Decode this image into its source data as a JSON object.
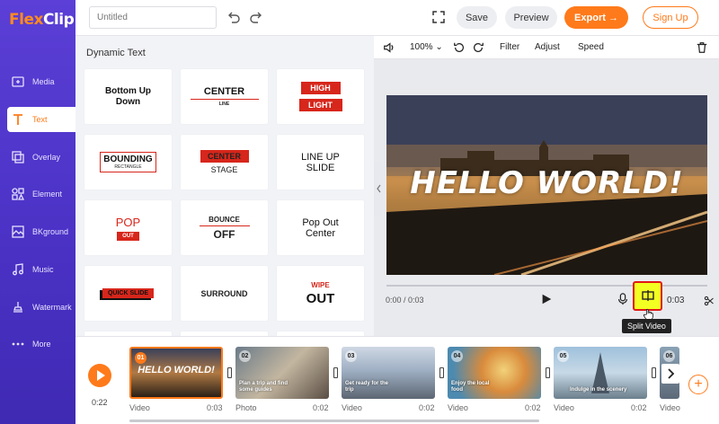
{
  "app": {
    "logo_text_a": "Flex",
    "logo_text_b": "Clip",
    "accent_color": "#ff7a1a",
    "sidebar_color": "#4a31c4"
  },
  "sidebar": {
    "items": [
      {
        "label": "Media",
        "icon": "media-icon"
      },
      {
        "label": "Text",
        "icon": "text-icon",
        "active": true
      },
      {
        "label": "Overlay",
        "icon": "overlay-icon"
      },
      {
        "label": "Element",
        "icon": "element-icon"
      },
      {
        "label": "BKground",
        "icon": "background-icon"
      },
      {
        "label": "Music",
        "icon": "music-icon"
      },
      {
        "label": "Watermark",
        "icon": "watermark-icon"
      },
      {
        "label": "More",
        "icon": "more-icon"
      }
    ]
  },
  "header": {
    "title_placeholder": "Untitled",
    "save_label": "Save",
    "preview_label": "Preview",
    "export_label": "Export →",
    "signup_label": "Sign Up"
  },
  "panel": {
    "title": "Dynamic Text",
    "cards": [
      {
        "lines": [
          "Bottom Up",
          "Down"
        ]
      },
      {
        "lines": [
          "CENTER",
          "LINE"
        ]
      },
      {
        "lines": [
          "HIGH",
          "LIGHT"
        ]
      },
      {
        "lines": [
          "BOUNDING",
          "RECTANGLE"
        ]
      },
      {
        "lines": [
          "CENTER",
          "STAGE"
        ]
      },
      {
        "lines": [
          "LINE UP",
          "SLIDE"
        ]
      },
      {
        "lines": [
          "POP",
          "OUT"
        ]
      },
      {
        "lines": [
          "BOUNCE",
          "OFF"
        ]
      },
      {
        "lines": [
          "Pop Out",
          "Center"
        ]
      },
      {
        "lines": [
          "QUICK SLIDE"
        ]
      },
      {
        "lines": [
          "SURROUND"
        ]
      },
      {
        "lines": [
          "WIPE",
          "OUT"
        ]
      }
    ]
  },
  "preview": {
    "zoom": "100%",
    "filter_label": "Filter",
    "adjust_label": "Adjust",
    "speed_label": "Speed",
    "canvas_text": "HELLO WORLD!",
    "current_time": "0:00 / 0:03",
    "end_time": "0:03",
    "tooltip": "Split Video"
  },
  "timeline": {
    "total_time": "0:22",
    "clips": [
      {
        "num": "01",
        "type": "Video",
        "duration": "0:03",
        "caption": "HELLO WORLD!"
      },
      {
        "num": "02",
        "type": "Photo",
        "duration": "0:02",
        "caption": "Plan a trip and find some guides"
      },
      {
        "num": "03",
        "type": "Video",
        "duration": "0:02",
        "caption": "Get ready for the trip"
      },
      {
        "num": "04",
        "type": "Video",
        "duration": "0:02",
        "caption": "Enjoy the local food"
      },
      {
        "num": "05",
        "type": "Video",
        "duration": "0:02",
        "caption": "Indulge in the scenery"
      },
      {
        "num": "06",
        "type": "Video",
        "duration": "",
        "caption": ""
      }
    ]
  }
}
